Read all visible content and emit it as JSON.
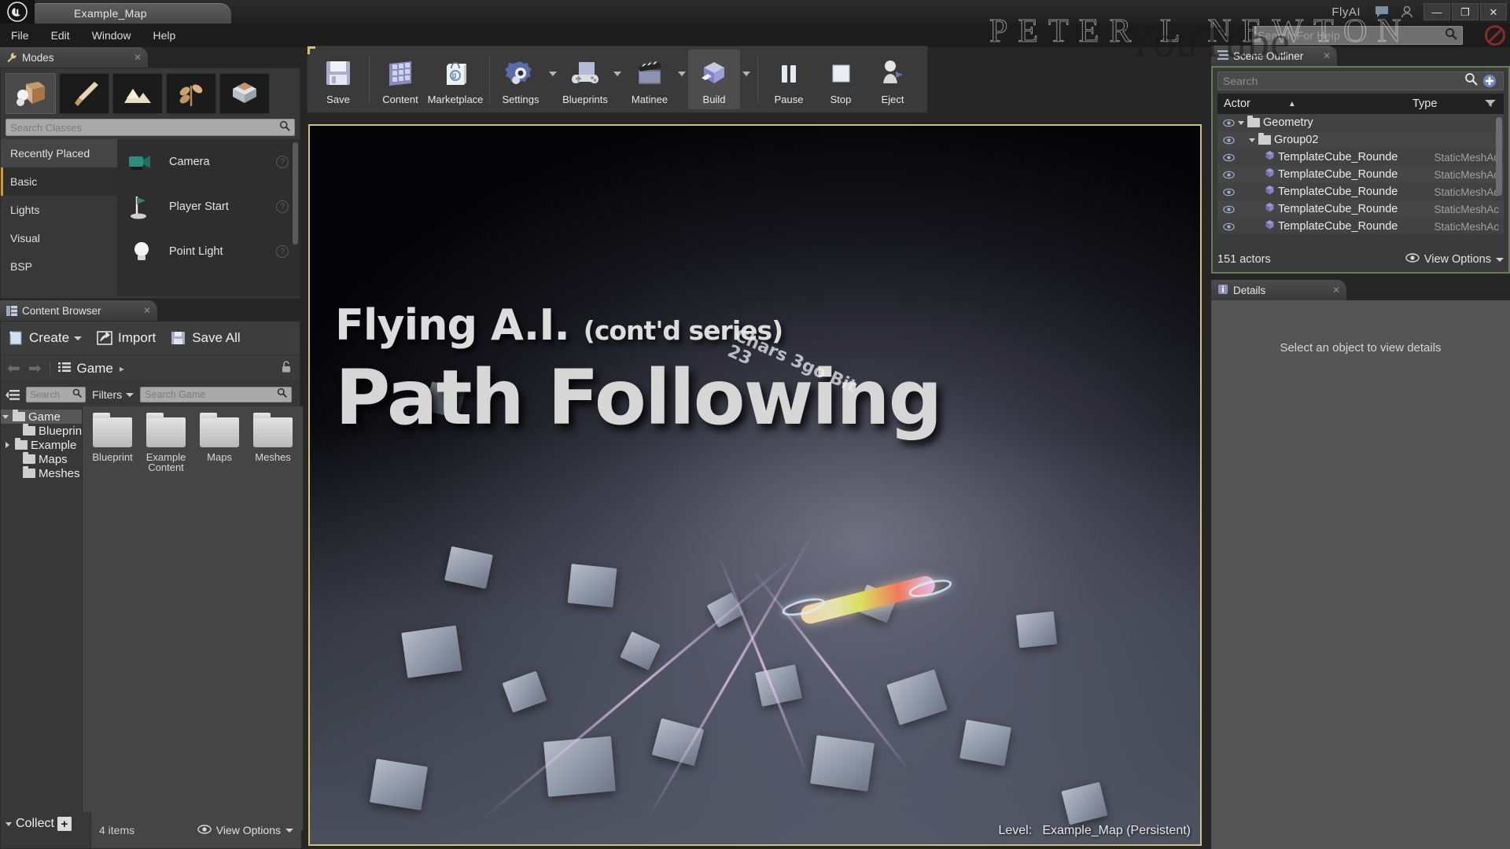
{
  "titlebar": {
    "map_tab": "Example_Map",
    "app_title": "FlyAI",
    "logo_icon": "unreal-logo-icon",
    "chat_icon": "feedback-bubble-icon",
    "account_icon": "user-account-icon",
    "minimize": "—",
    "maximize": "❐",
    "close": "✕"
  },
  "menu": {
    "items": [
      {
        "label": "File"
      },
      {
        "label": "Edit"
      },
      {
        "label": "Window"
      },
      {
        "label": "Help"
      }
    ],
    "help_search_placeholder": "Search For Help",
    "help_search_value": "",
    "search_icon": "search-icon",
    "no_entry_icon": "no-entry-icon"
  },
  "watermark": {
    "name": "PETER L NEWTON",
    "platform": "YouTube"
  },
  "modes": {
    "tab_label": "Modes",
    "tab_icon": "wrench-icon",
    "mode_buttons": [
      {
        "name": "place-mode",
        "icon": "place-mode-icon",
        "active": true
      },
      {
        "name": "paint-mode",
        "icon": "paint-brush-icon",
        "active": false
      },
      {
        "name": "landscape-mode",
        "icon": "landscape-icon",
        "active": false
      },
      {
        "name": "foliage-mode",
        "icon": "foliage-leaf-icon",
        "active": false
      },
      {
        "name": "geometry-edit-mode",
        "icon": "geometry-cube-icon",
        "active": false
      }
    ],
    "search_placeholder": "Search Classes",
    "search_value": "",
    "categories": [
      {
        "label": "Recently Placed",
        "selected": false
      },
      {
        "label": "Basic",
        "selected": true
      },
      {
        "label": "Lights",
        "selected": false
      },
      {
        "label": "Visual",
        "selected": false
      },
      {
        "label": "BSP",
        "selected": false
      }
    ],
    "placeable": [
      {
        "label": "Camera",
        "icon": "camera-actor-icon"
      },
      {
        "label": "Player Start",
        "icon": "player-start-icon"
      },
      {
        "label": "Point Light",
        "icon": "point-light-icon"
      }
    ],
    "help_glyph": "?"
  },
  "toolbar": {
    "groups": [
      {
        "buttons": [
          {
            "label": "Save",
            "icon": "floppy-save-icon",
            "dropdown": false
          },
          {
            "label": "Content",
            "icon": "content-grid-icon",
            "dropdown": false
          },
          {
            "label": "Marketplace",
            "icon": "marketplace-bag-icon",
            "dropdown": false
          }
        ]
      },
      {
        "buttons": [
          {
            "label": "Settings",
            "icon": "gear-settings-icon",
            "dropdown": true
          },
          {
            "label": "Blueprints",
            "icon": "blueprint-gamepad-icon",
            "dropdown": true
          },
          {
            "label": "Matinee",
            "icon": "matinee-clapper-icon",
            "dropdown": true
          },
          {
            "label": "Build",
            "icon": "build-cube-icon",
            "dropdown": true
          }
        ]
      },
      {
        "buttons": [
          {
            "label": "Pause",
            "icon": "pause-icon",
            "dropdown": false
          },
          {
            "label": "Stop",
            "icon": "stop-square-icon",
            "dropdown": false
          },
          {
            "label": "Eject",
            "icon": "eject-person-icon",
            "dropdown": false
          }
        ]
      }
    ]
  },
  "viewport": {
    "title_main": "Flying A.I.",
    "title_paren": "(cont'd series)",
    "title_sub": "Path Following",
    "scribble": "Chars 3go Bit 23",
    "level_label": "Level:",
    "level_value": "Example_Map (Persistent)"
  },
  "outliner": {
    "tab_label": "Scene Outliner",
    "tab_icon": "outliner-list-icon",
    "search_placeholder": "Search",
    "search_value": "",
    "search_icon": "search-icon",
    "add_icon": "add-item-icon",
    "columns": {
      "actor": "Actor",
      "type": "Type"
    },
    "sort_icon": "sort-ascending-icon",
    "filter_icon": "column-filter-icon",
    "rows": [
      {
        "name": "Geometry",
        "type": "",
        "depth": 0,
        "kind": "folder",
        "expanded": true,
        "eye": "eye-icon"
      },
      {
        "name": "Group02",
        "type": "",
        "depth": 1,
        "kind": "folder",
        "expanded": true,
        "eye": "eye-icon"
      },
      {
        "name": "TemplateCube_Rounde",
        "type": "StaticMeshAc",
        "depth": 2,
        "kind": "actor",
        "eye": "eye-icon"
      },
      {
        "name": "TemplateCube_Rounde",
        "type": "StaticMeshAc",
        "depth": 2,
        "kind": "actor",
        "eye": "eye-icon"
      },
      {
        "name": "TemplateCube_Rounde",
        "type": "StaticMeshAc",
        "depth": 2,
        "kind": "actor",
        "eye": "eye-icon"
      },
      {
        "name": "TemplateCube_Rounde",
        "type": "StaticMeshAc",
        "depth": 2,
        "kind": "actor",
        "eye": "eye-icon"
      },
      {
        "name": "TemplateCube_Rounde",
        "type": "StaticMeshAc",
        "depth": 2,
        "kind": "actor",
        "eye": "eye-icon"
      }
    ],
    "actor_count": "151 actors",
    "view_options": "View Options",
    "view_options_icon": "eye-icon"
  },
  "details": {
    "tab_label": "Details",
    "tab_icon": "details-info-icon",
    "empty_message": "Select an object to view details"
  },
  "content_browser": {
    "tab_label": "Content Browser",
    "tab_icon": "content-browser-icon",
    "buttons": {
      "create": "Create",
      "create_icon": "create-new-icon",
      "import": "Import",
      "import_icon": "import-arrow-icon",
      "save_all": "Save All",
      "save_all_icon": "save-all-icon"
    },
    "nav": {
      "back_icon": "arrow-left-icon",
      "forward_icon": "arrow-right-icon",
      "path_icon": "path-list-icon",
      "crumb": "Game",
      "crumb_caret": "▸",
      "lock_icon": "lock-open-icon"
    },
    "filters": {
      "sources_icon": "sources-panel-icon",
      "tree_search_placeholder": "Search",
      "tree_search_value": "",
      "filters_label": "Filters",
      "asset_search_placeholder": "Search Game",
      "asset_search_value": "",
      "search_icon": "search-icon"
    },
    "tree": [
      {
        "label": "Game",
        "depth": 0,
        "expanded": true,
        "selected": true,
        "arrow": "expanded"
      },
      {
        "label": "Blueprin",
        "depth": 1,
        "expanded": false,
        "selected": false,
        "arrow": "none"
      },
      {
        "label": "Example",
        "depth": 1,
        "expanded": false,
        "selected": false,
        "arrow": "collapsed"
      },
      {
        "label": "Maps",
        "depth": 1,
        "expanded": false,
        "selected": false,
        "arrow": "none"
      },
      {
        "label": "Meshes",
        "depth": 1,
        "expanded": false,
        "selected": false,
        "arrow": "none"
      }
    ],
    "assets": [
      {
        "label": "Blueprint",
        "icon": "folder-icon"
      },
      {
        "label": "Example Content",
        "icon": "folder-icon"
      },
      {
        "label": "Maps",
        "icon": "folder-icon"
      },
      {
        "label": "Meshes",
        "icon": "folder-icon"
      }
    ],
    "collections_label": "Collect",
    "collections_add": "+",
    "item_count": "4 items",
    "view_options": "View Options",
    "view_options_icon": "eye-icon"
  },
  "colors": {
    "accent_yellow": "#cdc47a",
    "outliner_border": "#6b7a57",
    "selection_orange": "#d19a2a",
    "panel_bg": "#383838",
    "details_bg": "#555555"
  }
}
